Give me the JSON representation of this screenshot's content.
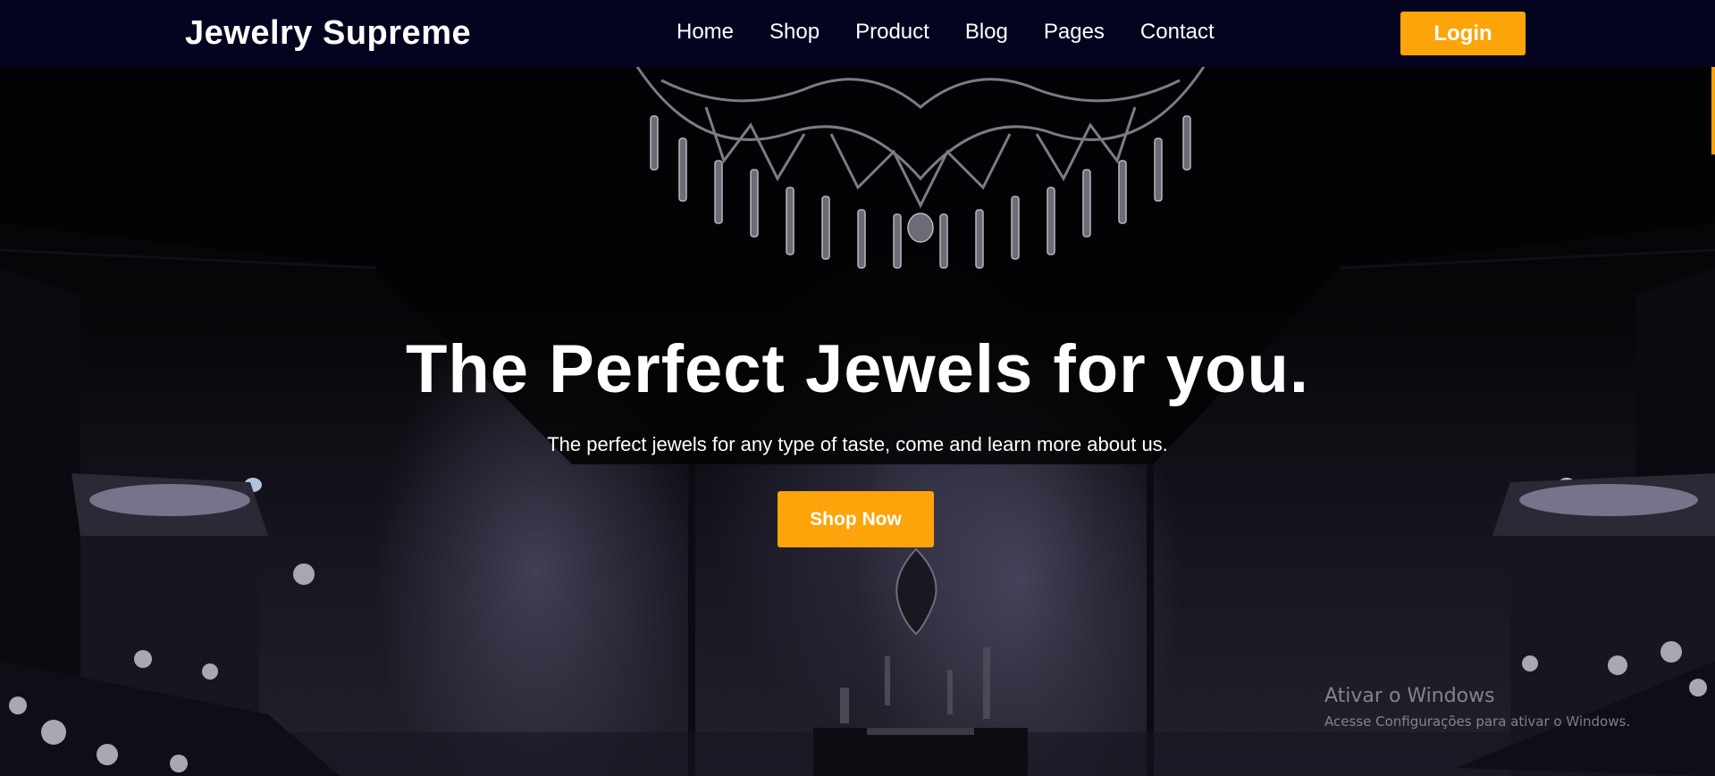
{
  "navbar": {
    "brand": "Jewelry Supreme",
    "links": [
      {
        "label": "Home"
      },
      {
        "label": "Shop"
      },
      {
        "label": "Product"
      },
      {
        "label": "Blog"
      },
      {
        "label": "Pages"
      },
      {
        "label": "Contact"
      }
    ],
    "login_label": "Login"
  },
  "hero": {
    "title": "The Perfect Jewels for you.",
    "subtitle": "The perfect jewels for any type of taste, come and learn more about us.",
    "cta_label": "Shop Now",
    "background_icon": "jewelry-store-interior-image"
  },
  "watermark": {
    "title": "Ativar o Windows",
    "subtitle": "Acesse Configurações para ativar o Windows."
  },
  "colors": {
    "navbar_bg": "#050420",
    "accent": "#fda40a",
    "text": "#ffffff"
  }
}
